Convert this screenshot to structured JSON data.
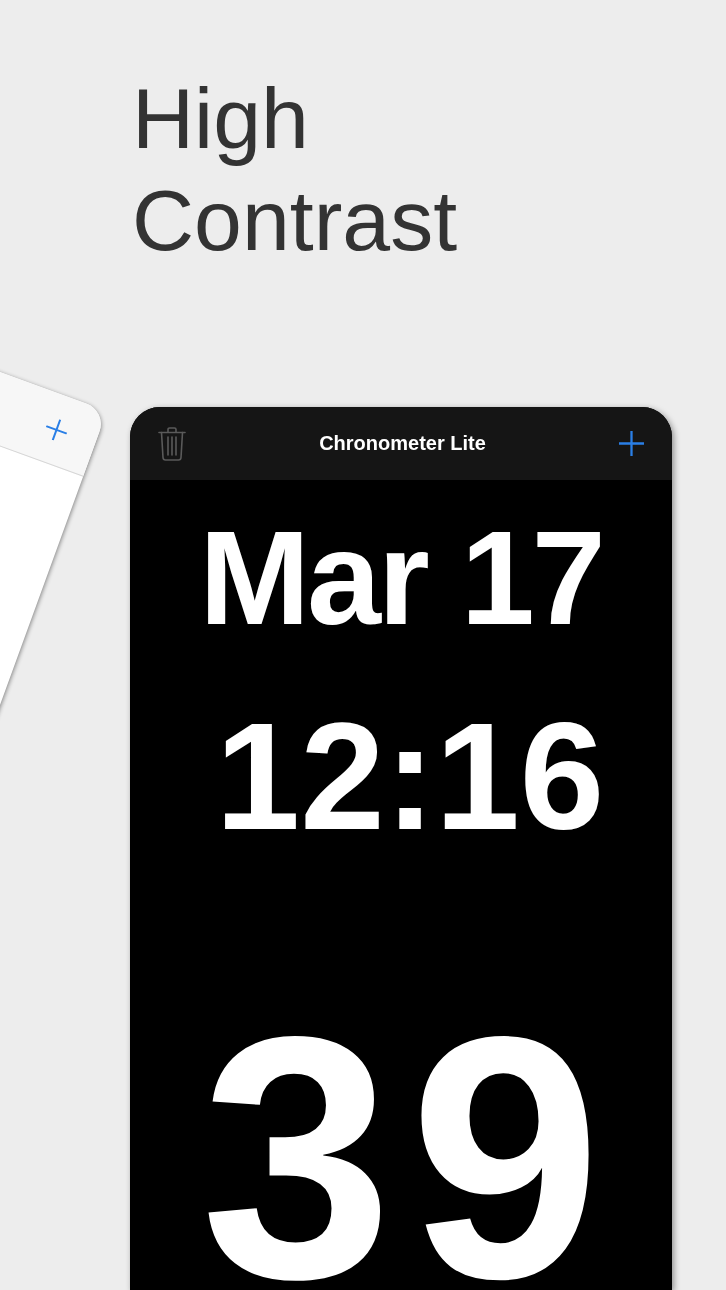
{
  "headline": "High Contrast",
  "app": {
    "title": "Chronometer Lite",
    "date": "Mar 17",
    "time": "12:16",
    "seconds": "39"
  }
}
